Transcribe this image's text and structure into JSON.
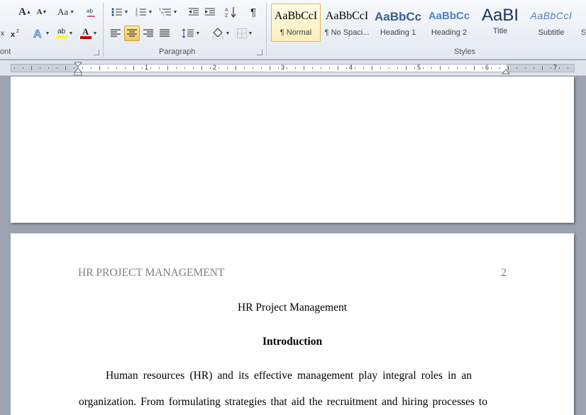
{
  "ribbon": {
    "groups": {
      "font": "ont",
      "paragraph": "Paragraph",
      "styles": "Styles"
    },
    "styles_gallery": [
      {
        "sample": "AaBbCcI",
        "name": "¶ Normal",
        "color": "#000000"
      },
      {
        "sample": "AaBbCcI",
        "name": "¶ No Spaci...",
        "color": "#000000"
      },
      {
        "sample": "AaBbCc",
        "name": "Heading 1",
        "color": "#365f91"
      },
      {
        "sample": "AaBbCc",
        "name": "Heading 2",
        "color": "#4f81bd"
      },
      {
        "sample": "AaBI",
        "name": "Title",
        "color": "#17365d"
      },
      {
        "sample": "AaBbCcI",
        "name": "Subtitle",
        "color": "#4f81bd"
      },
      {
        "sample": "",
        "name": "S",
        "color": "#000000"
      }
    ],
    "font_buttons": {
      "grow": "A",
      "shrink": "A",
      "change_case": "Aa",
      "highlight": "ab",
      "font_color": "A"
    },
    "show_marks": "¶"
  },
  "ruler": {
    "numbers": [
      "1",
      "2",
      "3",
      "4",
      "5",
      "6",
      "7"
    ]
  },
  "document": {
    "header_left": "HR PROJECT MANAGEMENT",
    "page_number": "2",
    "title": "HR Project Management",
    "heading": "Introduction",
    "lines": [
      "Human resources (HR) and its effective management play integral roles in an",
      "organization. From formulating strategies that aid the recruitment and hiring processes to"
    ]
  },
  "colors": {
    "accent_selected": "#f7c85c",
    "font_color_bar": "#c00000",
    "highlight_bar": "#ffff00",
    "heading_blue": "#365f91"
  }
}
